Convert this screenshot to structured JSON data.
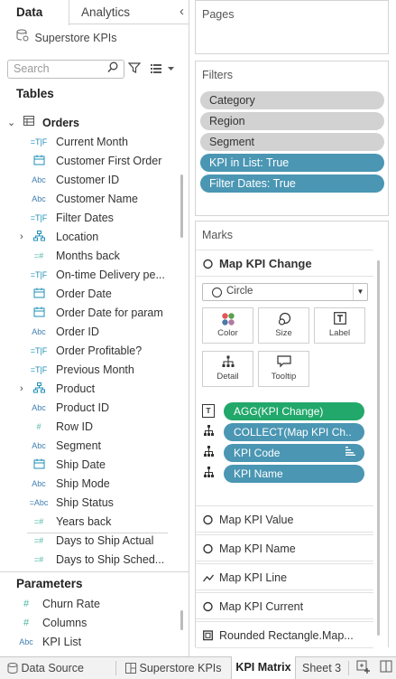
{
  "data_pane": {
    "tab_data": "Data",
    "tab_analytics": "Analytics",
    "collapse_glyph": "‹",
    "source": "Superstore KPIs",
    "search_placeholder": "Search",
    "tables_header": "Tables",
    "orders": {
      "label": "Orders",
      "chevron": "⌄",
      "icon": "table-icon"
    },
    "fields": [
      {
        "label": "Current Month",
        "type": "=T|F"
      },
      {
        "label": "Customer First Order",
        "type": "date"
      },
      {
        "label": "Customer ID",
        "type": "Abc"
      },
      {
        "label": "Customer Name",
        "type": "Abc"
      },
      {
        "label": "Filter Dates",
        "type": "=T|F"
      },
      {
        "label": "Location",
        "type": "hierarchy",
        "chevron": "›"
      },
      {
        "label": "Months back",
        "type": "=#"
      },
      {
        "label": "On-time Delivery pe...",
        "type": "=T|F"
      },
      {
        "label": "Order Date",
        "type": "date"
      },
      {
        "label": "Order Date for param",
        "type": "date"
      },
      {
        "label": "Order ID",
        "type": "Abc"
      },
      {
        "label": "Order Profitable?",
        "type": "=T|F"
      },
      {
        "label": "Previous Month",
        "type": "=T|F"
      },
      {
        "label": "Product",
        "type": "hierarchy",
        "chevron": "›"
      },
      {
        "label": "Product ID",
        "type": "Abc"
      },
      {
        "label": "Row ID",
        "type": "#"
      },
      {
        "label": "Segment",
        "type": "Abc"
      },
      {
        "label": "Ship Date",
        "type": "date"
      },
      {
        "label": "Ship Mode",
        "type": "Abc"
      },
      {
        "label": "Ship Status",
        "type": "=Abc"
      },
      {
        "label": "Years back",
        "type": "=#"
      },
      {
        "label": "Days to Ship Actual",
        "type": "=#"
      },
      {
        "label": "Days to Ship Sched...",
        "type": "=#"
      }
    ],
    "parameters_header": "Parameters",
    "parameters": [
      {
        "label": "Churn Rate",
        "type": "#"
      },
      {
        "label": "Columns",
        "type": "#"
      },
      {
        "label": "KPI List",
        "type": "Abc"
      }
    ]
  },
  "pages": {
    "title": "Pages"
  },
  "filters": {
    "title": "Filters",
    "pills": [
      {
        "label": "Category",
        "style": "grey"
      },
      {
        "label": "Region",
        "style": "grey"
      },
      {
        "label": "Segment",
        "style": "grey"
      },
      {
        "label": "KPI in List: True",
        "style": "teal"
      },
      {
        "label": "Filter Dates: True",
        "style": "teal"
      }
    ]
  },
  "marks": {
    "title": "Marks",
    "active_layer": "Map KPI Change",
    "mark_type": "Circle",
    "buttons": [
      {
        "label": "Color",
        "icon": "color-dots-icon"
      },
      {
        "label": "Size",
        "icon": "size-icon"
      },
      {
        "label": "Label",
        "icon": "label-icon"
      },
      {
        "label": "Detail",
        "icon": "detail-icon"
      },
      {
        "label": "Tooltip",
        "icon": "tooltip-icon"
      }
    ],
    "shelf": [
      {
        "label": "AGG(KPI Change)",
        "icon": "T",
        "color": "green"
      },
      {
        "label": "COLLECT(Map KPI Ch..",
        "icon": "detail",
        "color": "blue"
      },
      {
        "label": "KPI Code",
        "icon": "detail",
        "color": "blue",
        "extra": "sort-icon"
      },
      {
        "label": "KPI Name",
        "icon": "detail",
        "color": "blue"
      }
    ],
    "layers": [
      {
        "label": "Map KPI Value",
        "icon": "circle"
      },
      {
        "label": "Map KPI Name",
        "icon": "circle"
      },
      {
        "label": "Map KPI Line",
        "icon": "line"
      },
      {
        "label": "Map KPI Current",
        "icon": "circle"
      },
      {
        "label": "Rounded Rectangle.Map...",
        "icon": "square"
      }
    ]
  },
  "bottom_tabs": {
    "data_source": "Data Source",
    "sheets": [
      "Superstore KPIs",
      "KPI Matrix",
      "Sheet 3"
    ],
    "active": "KPI Matrix"
  },
  "colors": {
    "teal_pill": "#4a96b3",
    "green_pill": "#21a86a",
    "grey_pill": "#d2d2d2"
  }
}
